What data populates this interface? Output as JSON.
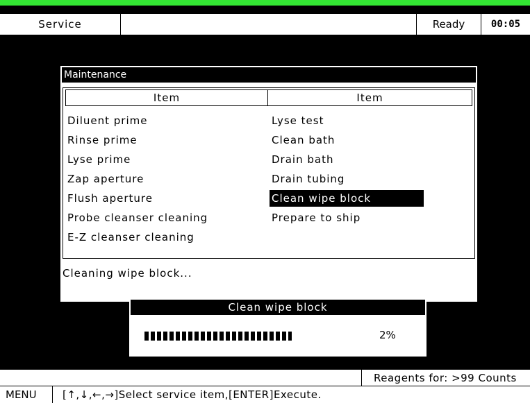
{
  "header": {
    "screen": "Service",
    "status": "Ready",
    "time": "00:05"
  },
  "panel": {
    "title": "Maintenance",
    "col1_header": "Item",
    "col2_header": "Item",
    "col1_items": [
      "Diluent prime",
      "Rinse prime",
      "Lyse prime",
      "Zap aperture",
      "Flush aperture",
      "Probe cleanser cleaning",
      "E-Z cleanser cleaning"
    ],
    "col2_items": [
      "Lyse test",
      "Clean bath",
      "Drain bath",
      "Drain tubing",
      "Clean wipe block",
      "Prepare to ship"
    ],
    "selected_item": "Clean wipe block",
    "message": "Cleaning wipe block..."
  },
  "dialog": {
    "title": "Clean wipe block",
    "progress_percent": 2,
    "progress_text": "2%"
  },
  "footer": {
    "reagents": "Reagents for: >99 Counts"
  },
  "helpbar": {
    "menu": "MENU",
    "help": "[↑,↓,←,→]Select service item,[ENTER]Execute."
  },
  "colors": {
    "accent": "#33e633",
    "background": "#000000",
    "panel": "#ffffff"
  }
}
